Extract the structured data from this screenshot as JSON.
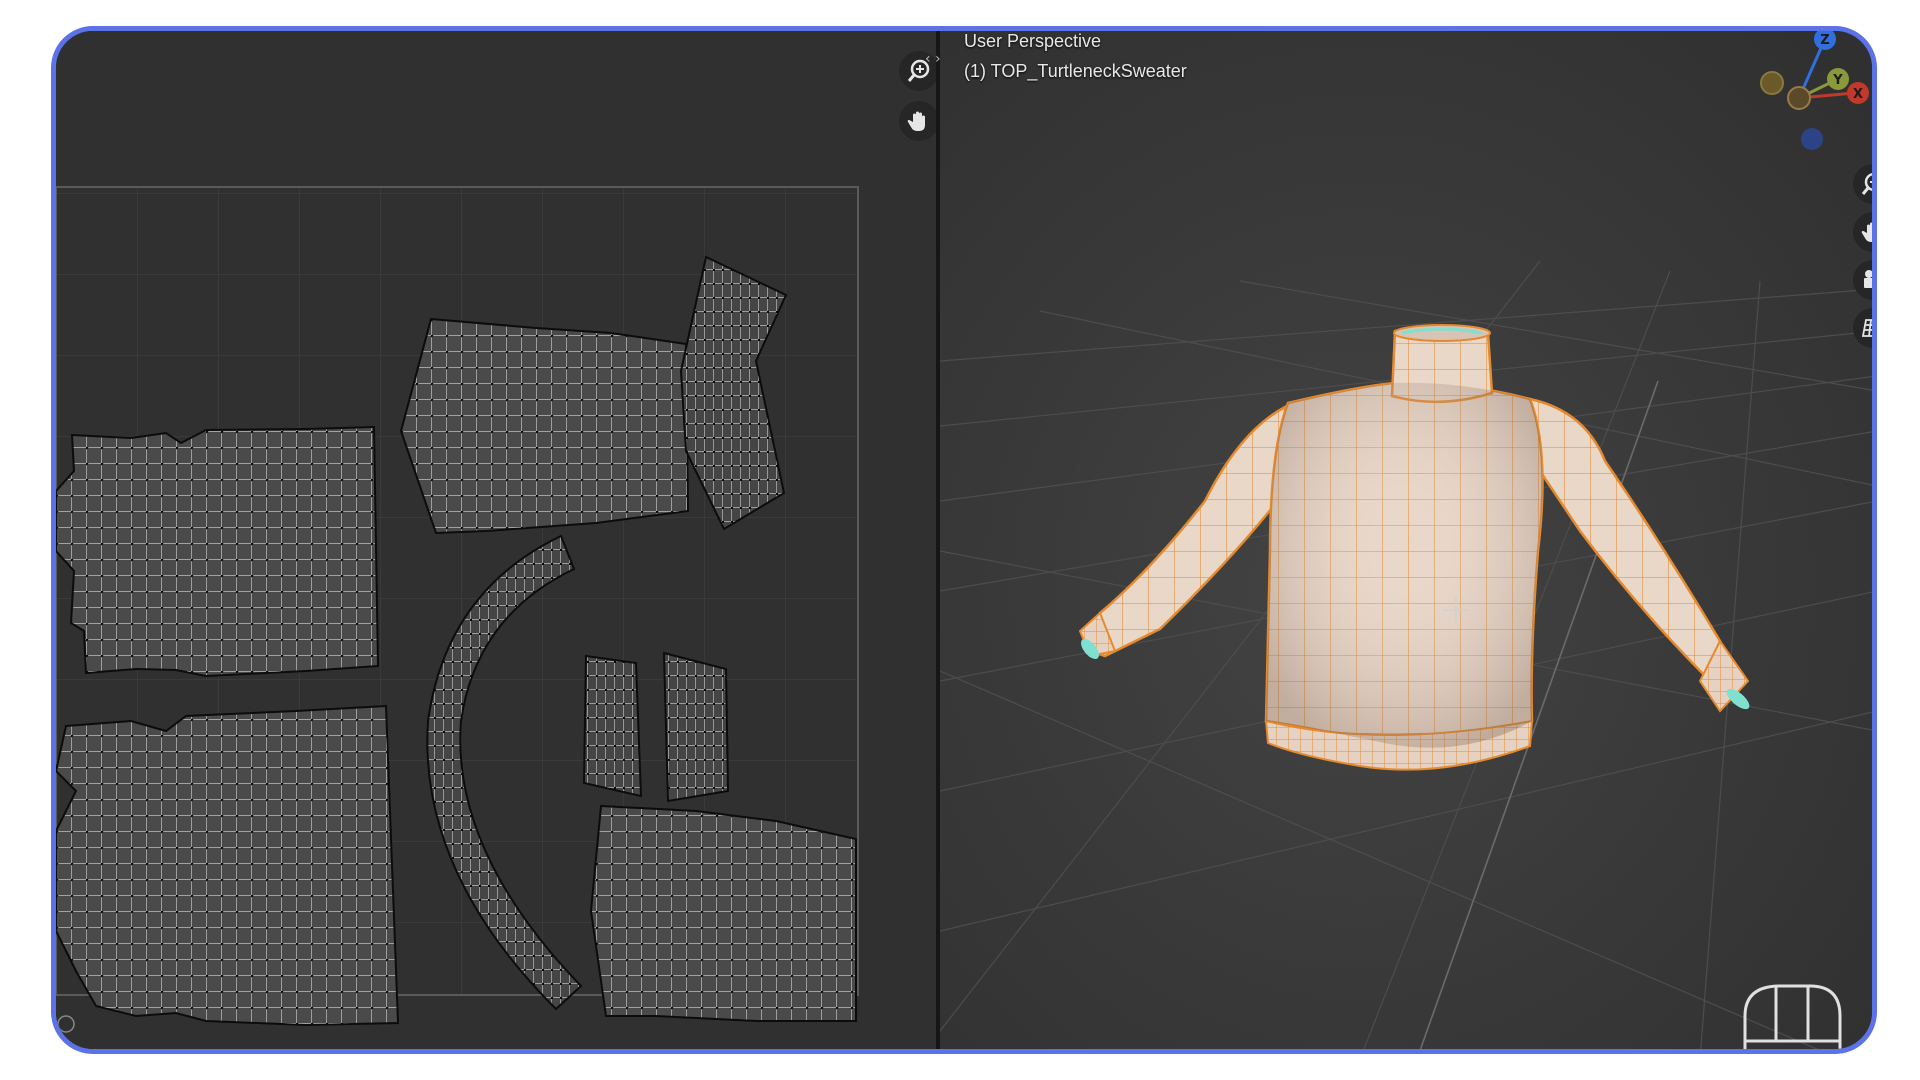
{
  "viewport": {
    "view_name": "User Perspective",
    "object_name": "(1) TOP_TurtleneckSweater"
  },
  "gizmo": {
    "z_label": "Z",
    "y_label": "Y",
    "x_label": "X",
    "colors": {
      "z": "#2f6fe0",
      "y": "#8a9a3a",
      "x": "#c0392b"
    }
  },
  "icons": {
    "uv_zoom": "zoom-icon",
    "uv_pan": "hand-pan-icon",
    "split": "split-arrows-icon",
    "vp_zoom": "zoom-icon",
    "vp_pan": "hand-pan-icon",
    "vp_camera": "camera-icon",
    "vp_ortho": "grid-perspective-icon"
  },
  "colors": {
    "frame_border": "#5b72e8",
    "mesh_orange": "#e58a2e",
    "sweater_fill": "#e9d7c8"
  }
}
